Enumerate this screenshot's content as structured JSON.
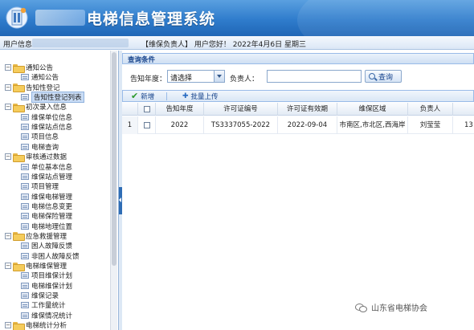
{
  "header": {
    "title": "电梯信息管理系统"
  },
  "infobar": {
    "user_label": "用户信息",
    "status": "【维保负责人】 用户您好！ 2022年4月6日 星期三"
  },
  "sidebar": {
    "nodes": [
      {
        "label": "通知公告",
        "type": "folder"
      },
      {
        "label": "通知公告",
        "type": "page"
      },
      {
        "label": "告知性登记",
        "type": "folder"
      },
      {
        "label": "告知性登记列表",
        "type": "page",
        "selected": true
      },
      {
        "label": "初次录入信息",
        "type": "folder"
      },
      {
        "label": "维保单位信息",
        "type": "page"
      },
      {
        "label": "维保站点信息",
        "type": "page"
      },
      {
        "label": "项目信息",
        "type": "page"
      },
      {
        "label": "电梯查询",
        "type": "page"
      },
      {
        "label": "审核通过数据",
        "type": "folder"
      },
      {
        "label": "单位基本信息",
        "type": "page"
      },
      {
        "label": "维保站点管理",
        "type": "page"
      },
      {
        "label": "项目管理",
        "type": "page"
      },
      {
        "label": "维保电梯管理",
        "type": "page"
      },
      {
        "label": "电梯信息变更",
        "type": "page"
      },
      {
        "label": "电梯保险管理",
        "type": "page"
      },
      {
        "label": "电梯地理位置",
        "type": "page"
      },
      {
        "label": "应急救援管理",
        "type": "folder"
      },
      {
        "label": "困人故障反馈",
        "type": "page"
      },
      {
        "label": "非困人故障反馈",
        "type": "page"
      },
      {
        "label": "电梯维保管理",
        "type": "folder"
      },
      {
        "label": "项目维保计划",
        "type": "page"
      },
      {
        "label": "电梯维保计划",
        "type": "page"
      },
      {
        "label": "维保记录",
        "type": "page"
      },
      {
        "label": "工作量统计",
        "type": "page"
      },
      {
        "label": "维保情况统计",
        "type": "page"
      },
      {
        "label": "电梯统计分析",
        "type": "folder"
      }
    ]
  },
  "query": {
    "panel_title": "查询条件",
    "year_label": "告知年度：",
    "year_value": "请选择",
    "owner_label": "负责人：",
    "owner_value": "",
    "search_label": "查询"
  },
  "toolbar": {
    "add_label": "新增",
    "upload_label": "批量上传"
  },
  "grid": {
    "columns": [
      "告知年度",
      "许可证编号",
      "许可证有效期",
      "维保区域",
      "负责人"
    ],
    "rows": [
      {
        "index": "1",
        "year": "2022",
        "license": "TS3337055-2022",
        "expiry": "2022-09-04",
        "area": "市南区,市北区,西海岸",
        "owner": "刘莹莹",
        "extra": "13"
      }
    ]
  },
  "watermark": {
    "text": "山东省电梯协会"
  }
}
